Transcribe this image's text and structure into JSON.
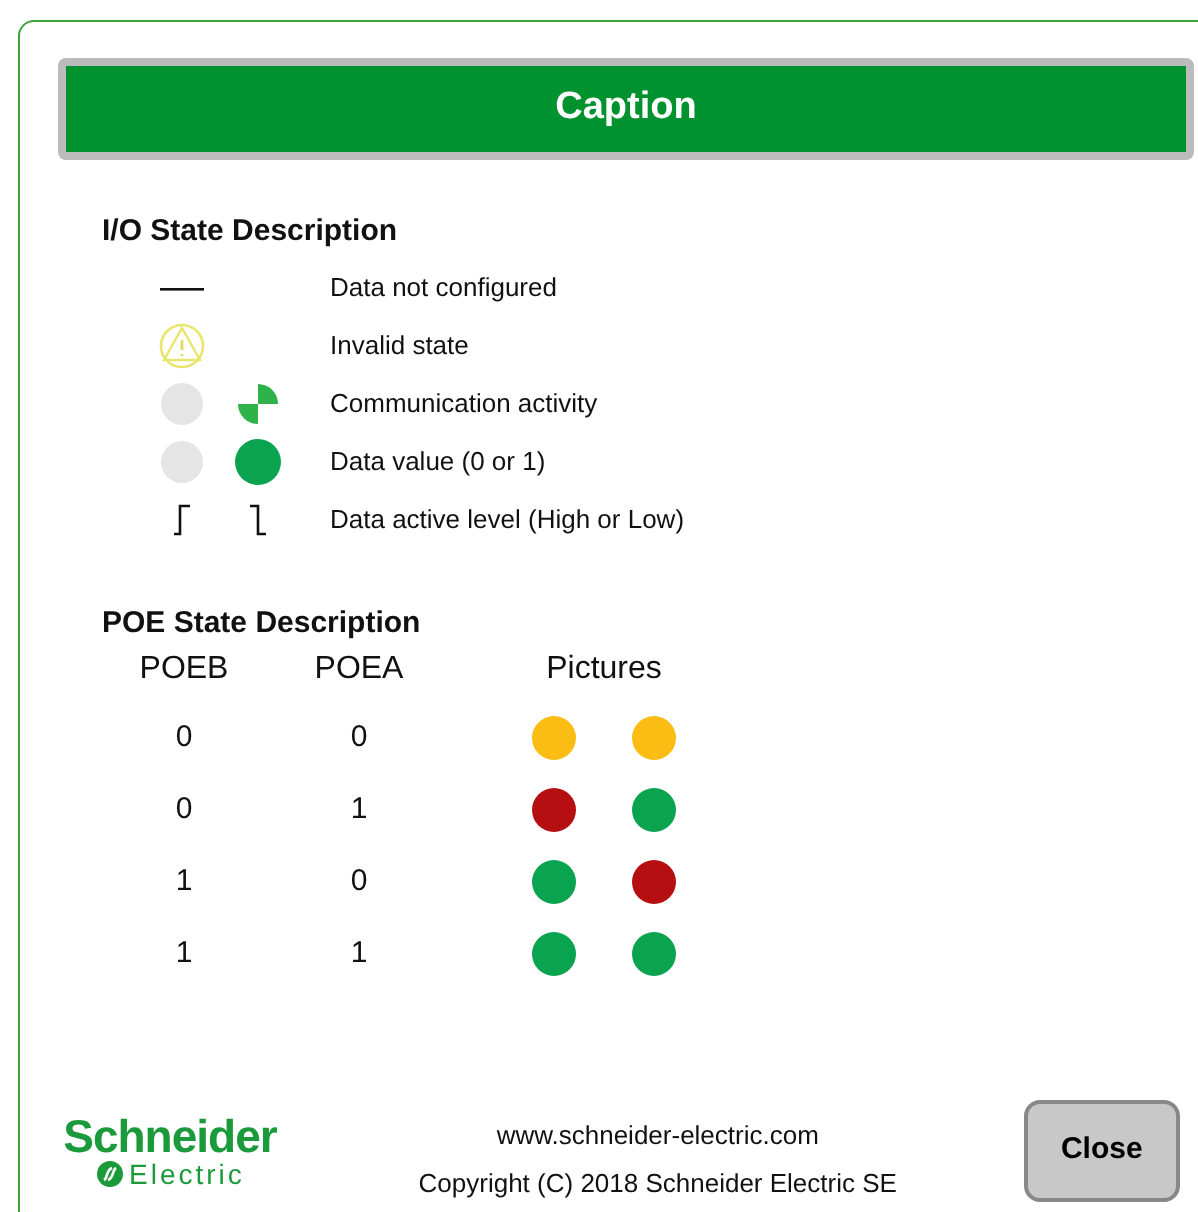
{
  "caption": "Caption",
  "io_state": {
    "title": "I/O State Description",
    "items": [
      {
        "kind": "dash",
        "label": "Data not configured"
      },
      {
        "kind": "warning",
        "label": "Invalid state"
      },
      {
        "kind": "activity",
        "label": "Communication activity"
      },
      {
        "kind": "value",
        "label": "Data value (0 or 1)"
      },
      {
        "kind": "level",
        "label": "Data active level (High or Low)"
      }
    ]
  },
  "poe_state": {
    "title": "POE State Description",
    "columns": [
      "POEB",
      "POEA",
      "Pictures"
    ],
    "rows": [
      {
        "poeb": "0",
        "poea": "0",
        "lights": [
          {
            "color": "#fbbc14"
          },
          {
            "color": "#fbbc14"
          }
        ]
      },
      {
        "poeb": "0",
        "poea": "1",
        "lights": [
          {
            "color": "#b50f12"
          },
          {
            "color": "#0aa34f"
          }
        ]
      },
      {
        "poeb": "1",
        "poea": "0",
        "lights": [
          {
            "color": "#0aa34f"
          },
          {
            "color": "#b50f12"
          }
        ]
      },
      {
        "poeb": "1",
        "poea": "1",
        "lights": [
          {
            "color": "#0aa34f"
          },
          {
            "color": "#0aa34f"
          }
        ]
      }
    ]
  },
  "footer": {
    "logo": {
      "name": "Schneider",
      "sub": "Electric"
    },
    "website": "www.schneider-electric.com",
    "copyright": "Copyright (C) 2018 Schneider Electric SE",
    "close_button": "Close"
  }
}
